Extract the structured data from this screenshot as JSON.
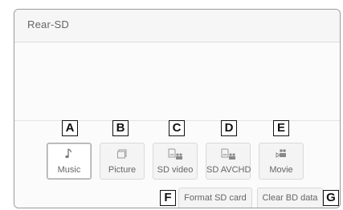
{
  "screen": {
    "title": "Rear-SD"
  },
  "callouts": {
    "a": "A",
    "b": "B",
    "c": "C",
    "d": "D",
    "e": "E",
    "f": "F",
    "g": "G"
  },
  "sources": [
    {
      "label": "Music",
      "icon": "music-note-icon",
      "selected": true
    },
    {
      "label": "Picture",
      "icon": "picture-icon",
      "selected": false
    },
    {
      "label": "SD video",
      "icon": "sd-video-icon",
      "selected": false
    },
    {
      "label": "SD AVCHD",
      "icon": "sd-avchd-icon",
      "selected": false
    },
    {
      "label": "Movie",
      "icon": "movie-icon",
      "selected": false
    }
  ],
  "actions": {
    "format_sd": "Format SD card",
    "clear_bd": "Clear BD data"
  }
}
